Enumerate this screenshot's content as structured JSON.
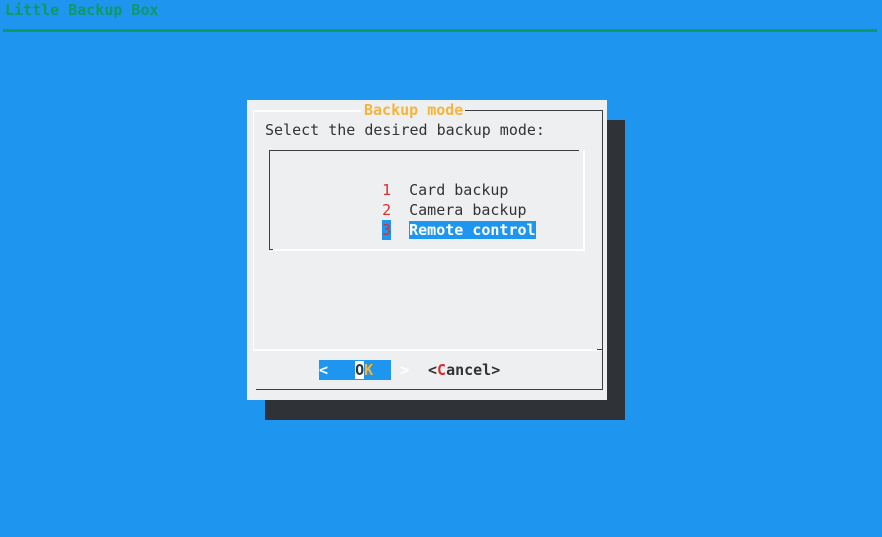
{
  "backtitle": "Little Backup Box",
  "dialog": {
    "title": "Backup mode",
    "prompt": "Select the desired backup mode:"
  },
  "menu": {
    "items": [
      {
        "tag": "1",
        "label": "Card backup",
        "selected": false
      },
      {
        "tag": "2",
        "label": "Camera backup",
        "selected": false
      },
      {
        "tag": "3",
        "label": "Remote control",
        "selected": true
      }
    ]
  },
  "buttons": {
    "ok": {
      "left": "<",
      "first": "O",
      "hot": "K",
      "right": ">"
    },
    "cancel": {
      "left": "<",
      "hot": "C",
      "rest": "ancel",
      "right": ">"
    }
  },
  "colors": {
    "background": "#1e96ef",
    "dialog": "#eeeff0",
    "shadow": "#2f3237",
    "title": "#f5b43a",
    "backtitle": "#0f9a63",
    "tag": "#d92e2e"
  }
}
